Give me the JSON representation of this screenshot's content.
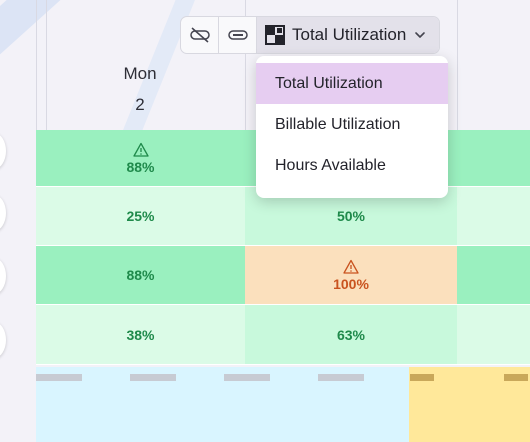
{
  "day": {
    "name": "Mon",
    "number": "2"
  },
  "toolbar": {
    "dropdown_label": "Total Utilization",
    "icons": [
      "eye-slash-icon",
      "bar-icon",
      "grid-icon",
      "chevron-down-icon"
    ]
  },
  "menu": {
    "items": [
      {
        "label": "Total Utilization",
        "selected": true
      },
      {
        "label": "Billable Utilization",
        "selected": false
      },
      {
        "label": "Hours Available",
        "selected": false
      }
    ]
  },
  "rows": [
    {
      "col1": "88%",
      "col1_warning": true,
      "col2": "",
      "col2_warning": false
    },
    {
      "col1": "25%",
      "col1_warning": false,
      "col2": "50%",
      "col2_warning": false
    },
    {
      "col1": "88%",
      "col1_warning": false,
      "col2": "100%",
      "col2_warning": true
    },
    {
      "col1": "38%",
      "col1_warning": false,
      "col2": "63%",
      "col2_warning": false
    }
  ],
  "colors": {
    "selected_menu": "#e6cdf1",
    "green": "#9af0bf",
    "light_green": "#c8f9dc",
    "orange": "#fbe0bd",
    "accent_text_green": "#1f8a4b",
    "accent_text_orange": "#c9531f"
  }
}
